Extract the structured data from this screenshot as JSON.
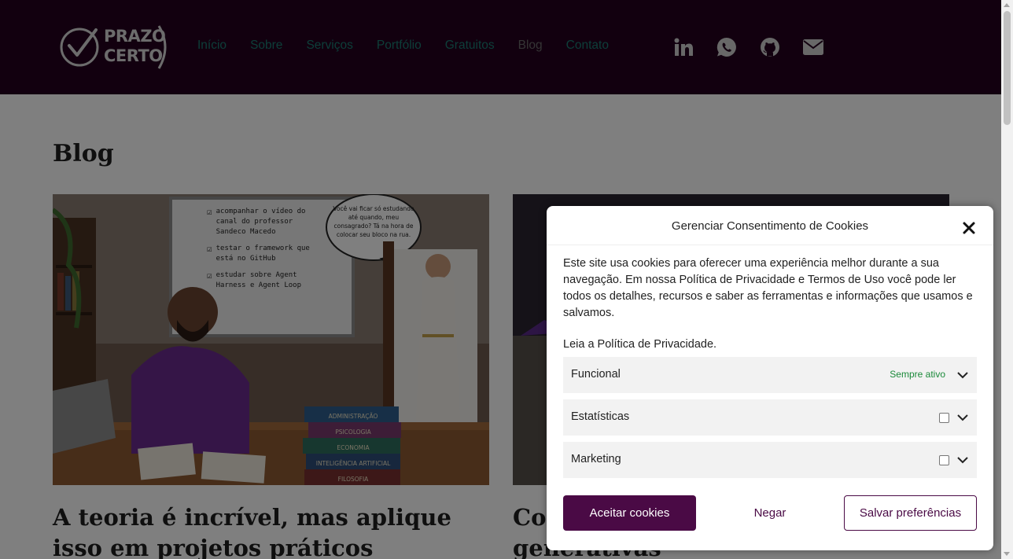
{
  "logo": {
    "line1": "PRAZO",
    "line2": "CERTO"
  },
  "nav": [
    "Início",
    "Sobre",
    "Serviços",
    "Portfólio",
    "Gratuitos",
    "Blog",
    "Contato"
  ],
  "social": [
    "linkedin-icon",
    "whatsapp-icon",
    "github-icon",
    "envelope-icon"
  ],
  "page_title": "Blog",
  "posts": [
    {
      "title": "A teoria é incrível, mas aplique isso em projetos práticos",
      "image": {
        "checklist": [
          "acompanhar o vídeo do canal do professor Sandeco Macedo",
          "testar o framework que está no GitHub",
          "estudar sobre Agent Harness e Agent Loop"
        ],
        "speech": "Você vai ficar só estudando até quando, meu consagrado? Tá na hora de colocar seu bloco na rua.",
        "books": [
          "ADMINISTRAÇÃO",
          "PSICOLOGIA",
          "ECONOMIA",
          "INTELIGÊNCIA ARTIFICIAL",
          "FILOSOFIA"
        ]
      }
    },
    {
      "title": "Co… comunicação com IAs generativas"
    }
  ],
  "cookie_modal": {
    "title": "Gerenciar Consentimento de Cookies",
    "message": "Este site usa cookies para oferecer uma experiência melhor durante a sua navegação. Em nossa Política de Privacidade e Termos de Uso você pode ler todos os detalhes, recursos e saber as ferramentas e informações que usamos e salvamos.",
    "policy_link": "Leia a Política de Privacidade.",
    "categories": [
      {
        "label": "Funcional",
        "status": "Sempre ativo"
      },
      {
        "label": "Estatísticas"
      },
      {
        "label": "Marketing"
      }
    ],
    "accept_label": "Aceitar cookies",
    "deny_label": "Negar",
    "save_label": "Salvar preferências"
  },
  "colors": {
    "header_bg": "#24001f",
    "nav_link": "#1a7d72",
    "nav_active": "#6b6b6b",
    "brand_purple": "#4a0a45",
    "always_active_green": "#1b8a3a"
  }
}
